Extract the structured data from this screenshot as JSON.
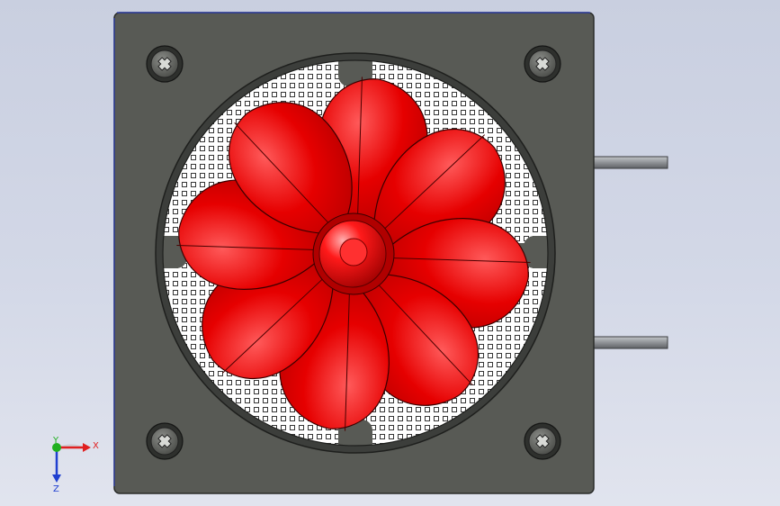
{
  "viewport": {
    "background_top": "#c9cfe0",
    "background_bottom": "#e1e4ee"
  },
  "model": {
    "housing_color": "#585a55",
    "grille_color": "#ffffff",
    "blade_color": "#e00000",
    "shaft_color": "#8f9296",
    "blade_count": 8,
    "screws": [
      "screw-top-left",
      "screw-top-right",
      "screw-bottom-left",
      "screw-bottom-right"
    ]
  },
  "triad": {
    "x_label": "X",
    "y_label": "Y",
    "z_label": "Z",
    "x_color": "#e02020",
    "y_color": "#20b020",
    "z_color": "#2040d0"
  }
}
